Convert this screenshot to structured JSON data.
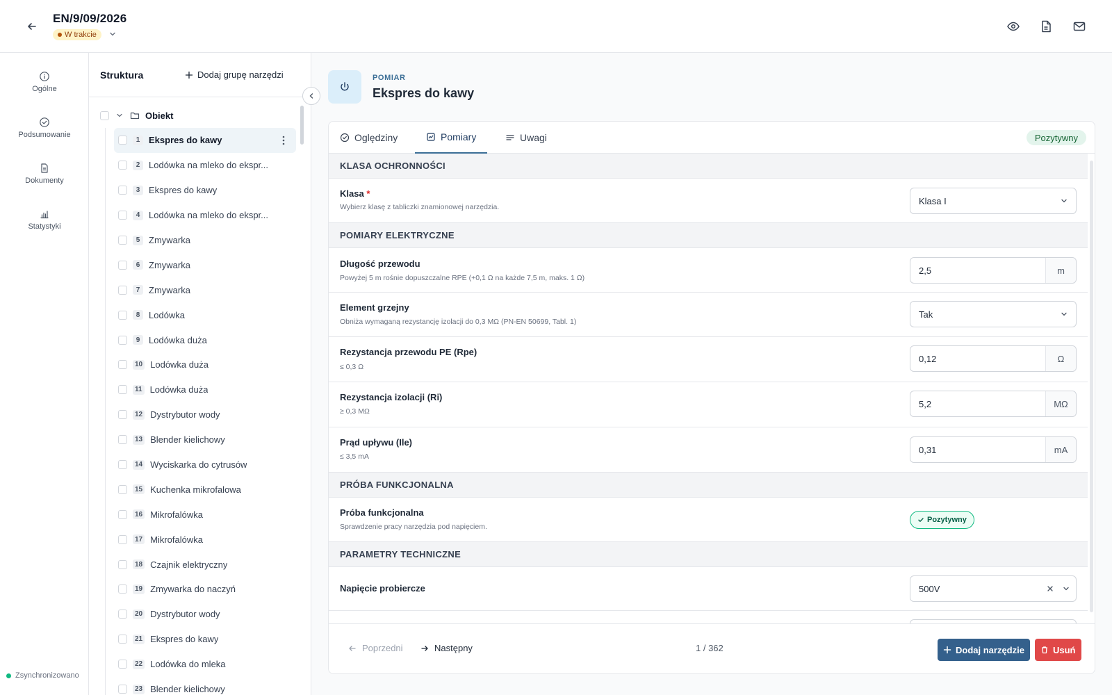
{
  "header": {
    "title": "EN/9/09/2026",
    "status": "W trakcie"
  },
  "rail": {
    "items": [
      {
        "label": "Ogólne",
        "icon": "info-icon"
      },
      {
        "label": "Podsumowanie",
        "icon": "check-circle-icon"
      },
      {
        "label": "Dokumenty",
        "icon": "document-icon"
      },
      {
        "label": "Statystyki",
        "icon": "chart-icon"
      }
    ],
    "sync_status": "Zsynchronizowano"
  },
  "tree": {
    "title": "Struktura",
    "add_group_label": "Dodaj grupę narzędzi",
    "root_label": "Obiekt",
    "items": [
      {
        "num": "1",
        "label": "Ekspres do kawy"
      },
      {
        "num": "2",
        "label": "Lodówka na mleko do ekspr..."
      },
      {
        "num": "3",
        "label": "Ekspres do kawy"
      },
      {
        "num": "4",
        "label": "Lodówka na mleko do ekspr..."
      },
      {
        "num": "5",
        "label": "Zmywarka"
      },
      {
        "num": "6",
        "label": "Zmywarka"
      },
      {
        "num": "7",
        "label": "Zmywarka"
      },
      {
        "num": "8",
        "label": "Lodówka"
      },
      {
        "num": "9",
        "label": "Lodówka duża"
      },
      {
        "num": "10",
        "label": "Lodówka duża"
      },
      {
        "num": "11",
        "label": "Lodówka duża"
      },
      {
        "num": "12",
        "label": "Dystrybutor wody"
      },
      {
        "num": "13",
        "label": "Blender kielichowy"
      },
      {
        "num": "14",
        "label": "Wyciskarka do cytrusów"
      },
      {
        "num": "15",
        "label": "Kuchenka mikrofalowa"
      },
      {
        "num": "16",
        "label": "Mikrofalówka"
      },
      {
        "num": "17",
        "label": "Mikrofalówka"
      },
      {
        "num": "18",
        "label": "Czajnik elektryczny"
      },
      {
        "num": "19",
        "label": "Zmywarka do naczyń"
      },
      {
        "num": "20",
        "label": "Dystrybutor wody"
      },
      {
        "num": "21",
        "label": "Ekspres do kawy"
      },
      {
        "num": "22",
        "label": "Lodówka do mleka"
      },
      {
        "num": "23",
        "label": "Blender kielichowy"
      }
    ]
  },
  "tool": {
    "kicker": "POMIAR",
    "title": "Ekspres do kawy"
  },
  "tabs": {
    "inspection": "Oględziny",
    "measurements": "Pomiary",
    "notes": "Uwagi",
    "result": "Pozytywny"
  },
  "form": {
    "section_class": "KLASA OCHRONNOŚCI",
    "class": {
      "label": "Klasa",
      "required_mark": "*",
      "help": "Wybierz klasę z tabliczki znamionowej narzędzia.",
      "value": "Klasa I"
    },
    "section_electrical": "POMIARY ELEKTRYCZNE",
    "cable_length": {
      "label": "Długość przewodu",
      "help": "Powyżej 5 m rośnie dopuszczalne RPE (+0,1 Ω na każde 7,5 m, maks. 1 Ω)",
      "value": "2,5",
      "unit": "m"
    },
    "heating": {
      "label": "Element grzejny",
      "help": "Obniża wymaganą rezystancję izolacji do 0,3 MΩ (PN-EN 50699, Tabl. 1)",
      "value": "Tak"
    },
    "rpe": {
      "label": "Rezystancja przewodu PE (Rpe)",
      "help": "≤ 0,3 Ω",
      "value": "0,12",
      "unit": "Ω"
    },
    "ri": {
      "label": "Rezystancja izolacji (Ri)",
      "help": "≥ 0,3 MΩ",
      "value": "5,2",
      "unit": "MΩ"
    },
    "ile": {
      "label": "Prąd upływu (Ile)",
      "help": "≤ 3,5 mA",
      "value": "0,31",
      "unit": "mA"
    },
    "section_functional": "PRÓBA FUNKCJONALNA",
    "functional": {
      "label": "Próba funkcjonalna",
      "help": "Sprawdzenie pracy narzędzia pod napięciem.",
      "value": "Pozytywny"
    },
    "section_technical": "PARAMETRY TECHNICZNE",
    "test_voltage": {
      "label": "Napięcie probiercze",
      "value": "500V"
    }
  },
  "footer": {
    "prev_label": "Poprzedni",
    "next_label": "Następny",
    "pager": "1 / 362",
    "add_tool_label": "Dodaj narzędzie",
    "delete_label": "Usuń"
  },
  "colors": {
    "primary": "#34608c",
    "danger": "#e04848",
    "success": "#10b981",
    "warning_bg": "#fef3c7"
  }
}
